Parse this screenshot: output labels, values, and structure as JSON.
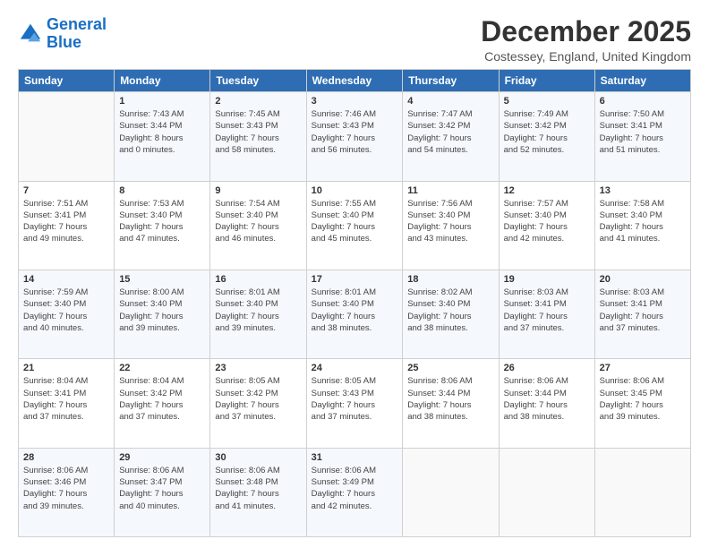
{
  "logo": {
    "line1": "General",
    "line2": "Blue"
  },
  "title": "December 2025",
  "subtitle": "Costessey, England, United Kingdom",
  "days_header": [
    "Sunday",
    "Monday",
    "Tuesday",
    "Wednesday",
    "Thursday",
    "Friday",
    "Saturday"
  ],
  "weeks": [
    [
      {
        "day": "",
        "info": ""
      },
      {
        "day": "1",
        "info": "Sunrise: 7:43 AM\nSunset: 3:44 PM\nDaylight: 8 hours\nand 0 minutes."
      },
      {
        "day": "2",
        "info": "Sunrise: 7:45 AM\nSunset: 3:43 PM\nDaylight: 7 hours\nand 58 minutes."
      },
      {
        "day": "3",
        "info": "Sunrise: 7:46 AM\nSunset: 3:43 PM\nDaylight: 7 hours\nand 56 minutes."
      },
      {
        "day": "4",
        "info": "Sunrise: 7:47 AM\nSunset: 3:42 PM\nDaylight: 7 hours\nand 54 minutes."
      },
      {
        "day": "5",
        "info": "Sunrise: 7:49 AM\nSunset: 3:42 PM\nDaylight: 7 hours\nand 52 minutes."
      },
      {
        "day": "6",
        "info": "Sunrise: 7:50 AM\nSunset: 3:41 PM\nDaylight: 7 hours\nand 51 minutes."
      }
    ],
    [
      {
        "day": "7",
        "info": "Sunrise: 7:51 AM\nSunset: 3:41 PM\nDaylight: 7 hours\nand 49 minutes."
      },
      {
        "day": "8",
        "info": "Sunrise: 7:53 AM\nSunset: 3:40 PM\nDaylight: 7 hours\nand 47 minutes."
      },
      {
        "day": "9",
        "info": "Sunrise: 7:54 AM\nSunset: 3:40 PM\nDaylight: 7 hours\nand 46 minutes."
      },
      {
        "day": "10",
        "info": "Sunrise: 7:55 AM\nSunset: 3:40 PM\nDaylight: 7 hours\nand 45 minutes."
      },
      {
        "day": "11",
        "info": "Sunrise: 7:56 AM\nSunset: 3:40 PM\nDaylight: 7 hours\nand 43 minutes."
      },
      {
        "day": "12",
        "info": "Sunrise: 7:57 AM\nSunset: 3:40 PM\nDaylight: 7 hours\nand 42 minutes."
      },
      {
        "day": "13",
        "info": "Sunrise: 7:58 AM\nSunset: 3:40 PM\nDaylight: 7 hours\nand 41 minutes."
      }
    ],
    [
      {
        "day": "14",
        "info": "Sunrise: 7:59 AM\nSunset: 3:40 PM\nDaylight: 7 hours\nand 40 minutes."
      },
      {
        "day": "15",
        "info": "Sunrise: 8:00 AM\nSunset: 3:40 PM\nDaylight: 7 hours\nand 39 minutes."
      },
      {
        "day": "16",
        "info": "Sunrise: 8:01 AM\nSunset: 3:40 PM\nDaylight: 7 hours\nand 39 minutes."
      },
      {
        "day": "17",
        "info": "Sunrise: 8:01 AM\nSunset: 3:40 PM\nDaylight: 7 hours\nand 38 minutes."
      },
      {
        "day": "18",
        "info": "Sunrise: 8:02 AM\nSunset: 3:40 PM\nDaylight: 7 hours\nand 38 minutes."
      },
      {
        "day": "19",
        "info": "Sunrise: 8:03 AM\nSunset: 3:41 PM\nDaylight: 7 hours\nand 37 minutes."
      },
      {
        "day": "20",
        "info": "Sunrise: 8:03 AM\nSunset: 3:41 PM\nDaylight: 7 hours\nand 37 minutes."
      }
    ],
    [
      {
        "day": "21",
        "info": "Sunrise: 8:04 AM\nSunset: 3:41 PM\nDaylight: 7 hours\nand 37 minutes."
      },
      {
        "day": "22",
        "info": "Sunrise: 8:04 AM\nSunset: 3:42 PM\nDaylight: 7 hours\nand 37 minutes."
      },
      {
        "day": "23",
        "info": "Sunrise: 8:05 AM\nSunset: 3:42 PM\nDaylight: 7 hours\nand 37 minutes."
      },
      {
        "day": "24",
        "info": "Sunrise: 8:05 AM\nSunset: 3:43 PM\nDaylight: 7 hours\nand 37 minutes."
      },
      {
        "day": "25",
        "info": "Sunrise: 8:06 AM\nSunset: 3:44 PM\nDaylight: 7 hours\nand 38 minutes."
      },
      {
        "day": "26",
        "info": "Sunrise: 8:06 AM\nSunset: 3:44 PM\nDaylight: 7 hours\nand 38 minutes."
      },
      {
        "day": "27",
        "info": "Sunrise: 8:06 AM\nSunset: 3:45 PM\nDaylight: 7 hours\nand 39 minutes."
      }
    ],
    [
      {
        "day": "28",
        "info": "Sunrise: 8:06 AM\nSunset: 3:46 PM\nDaylight: 7 hours\nand 39 minutes."
      },
      {
        "day": "29",
        "info": "Sunrise: 8:06 AM\nSunset: 3:47 PM\nDaylight: 7 hours\nand 40 minutes."
      },
      {
        "day": "30",
        "info": "Sunrise: 8:06 AM\nSunset: 3:48 PM\nDaylight: 7 hours\nand 41 minutes."
      },
      {
        "day": "31",
        "info": "Sunrise: 8:06 AM\nSunset: 3:49 PM\nDaylight: 7 hours\nand 42 minutes."
      },
      {
        "day": "",
        "info": ""
      },
      {
        "day": "",
        "info": ""
      },
      {
        "day": "",
        "info": ""
      }
    ]
  ]
}
